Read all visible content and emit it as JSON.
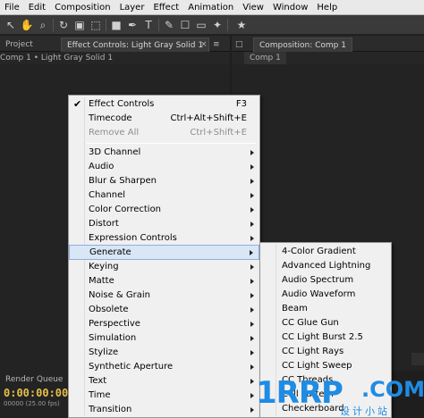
{
  "menubar": [
    "File",
    "Edit",
    "Composition",
    "Layer",
    "Effect",
    "Animation",
    "View",
    "Window",
    "Help"
  ],
  "toolbar": {
    "icons": [
      "selection-tool-icon",
      "hand-tool-icon",
      "zoom-tool-icon",
      "rotate-tool-icon",
      "camera-orbit-icon",
      "pan-behind-icon",
      "rectangle-mask-icon",
      "pen-tool-icon",
      "type-tool-icon",
      "brush-tool-icon",
      "clone-stamp-icon",
      "eraser-icon",
      "roto-brush-icon",
      "puppet-pin-icon"
    ]
  },
  "left_panel": {
    "tab_project": "Project",
    "tab_effect_controls": "Effect Controls: Light Gray Solid 1",
    "breadcrumb": "Comp 1 • Light Gray Solid 1"
  },
  "right_panel": {
    "tab_composition": "Composition: Comp 1",
    "comp_tab": "Comp 1"
  },
  "bottom_panel": {
    "tab": "Render Queue",
    "timecode": "0:00:00:00",
    "fps": "00000 (25.00 fps)"
  },
  "context_menu": {
    "items": [
      {
        "label": "Effect Controls",
        "shortcut": "F3",
        "checked": true
      },
      {
        "label": "Timecode",
        "shortcut": "Ctrl+Alt+Shift+E"
      },
      {
        "label": "Remove All",
        "shortcut": "Ctrl+Shift+E",
        "disabled": true
      },
      {
        "label": "3D Channel",
        "submenu": true
      },
      {
        "label": "Audio",
        "submenu": true
      },
      {
        "label": "Blur & Sharpen",
        "submenu": true
      },
      {
        "label": "Channel",
        "submenu": true
      },
      {
        "label": "Color Correction",
        "submenu": true
      },
      {
        "label": "Distort",
        "submenu": true
      },
      {
        "label": "Expression Controls",
        "submenu": true
      },
      {
        "label": "Generate",
        "submenu": true,
        "highlighted": true
      },
      {
        "label": "Keying",
        "submenu": true
      },
      {
        "label": "Matte",
        "submenu": true
      },
      {
        "label": "Noise & Grain",
        "submenu": true
      },
      {
        "label": "Obsolete",
        "submenu": true
      },
      {
        "label": "Perspective",
        "submenu": true
      },
      {
        "label": "Simulation",
        "submenu": true
      },
      {
        "label": "Stylize",
        "submenu": true
      },
      {
        "label": "Synthetic Aperture",
        "submenu": true
      },
      {
        "label": "Text",
        "submenu": true
      },
      {
        "label": "Time",
        "submenu": true
      },
      {
        "label": "Transition",
        "submenu": true
      }
    ]
  },
  "generate_submenu": {
    "items": [
      "4-Color Gradient",
      "Advanced Lightning",
      "Audio Spectrum",
      "Audio Waveform",
      "Beam",
      "CC Glue Gun",
      "CC Light Burst 2.5",
      "CC Light Rays",
      "CC Light Sweep",
      "CC Threads",
      "Cell Pattern",
      "Checkerboard"
    ]
  },
  "watermark": {
    "brand": "1RRP",
    "domain": ".COM",
    "tagline": "设计小站"
  }
}
